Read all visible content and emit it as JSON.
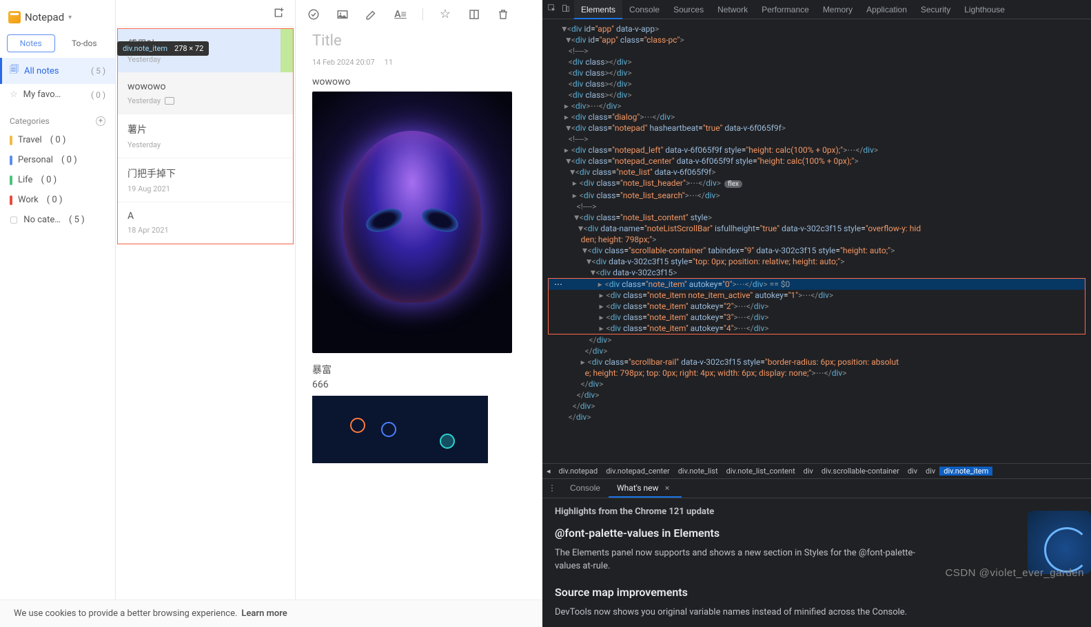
{
  "app": {
    "title": "Notepad",
    "tabs": {
      "notes": "Notes",
      "todos": "To-dos"
    },
    "nav": {
      "all": {
        "label": "All notes",
        "count": "( 5 )"
      },
      "fav": {
        "label": "My favo…",
        "count": "( 0 )"
      }
    },
    "categories_label": "Categories",
    "categories": [
      {
        "name": "Travel",
        "count": "( 0 )",
        "color": "#f5b942"
      },
      {
        "name": "Personal",
        "count": "( 0 )",
        "color": "#5b8def"
      },
      {
        "name": "Life",
        "count": "( 0 )",
        "color": "#4bc27d"
      },
      {
        "name": "Work",
        "count": "( 0 )",
        "color": "#e74c3c"
      },
      {
        "name": "No cate…",
        "count": "( 5 )",
        "color": "#c0c0c0"
      }
    ]
  },
  "tooltip": {
    "selector": "div.note_item",
    "dim": "278 × 72"
  },
  "notes": [
    {
      "title": "傅里叶",
      "date": "Yesterday",
      "hasImg": false,
      "state": "hover"
    },
    {
      "title": "wowowo",
      "date": "Yesterday",
      "hasImg": true,
      "state": "active"
    },
    {
      "title": "薯片",
      "date": "Yesterday",
      "hasImg": false,
      "state": ""
    },
    {
      "title": "门把手掉下",
      "date": "19 Aug 2021",
      "hasImg": false,
      "state": ""
    },
    {
      "title": "A",
      "date": "18 Apr 2021",
      "hasImg": false,
      "state": ""
    }
  ],
  "editor": {
    "title_placeholder": "Title",
    "meta_date": "14 Feb 2024 20:07",
    "meta_count": "11",
    "line1": "wowowo",
    "line2": "暴富",
    "line3": "666"
  },
  "cookie": {
    "text": "We use cookies to provide a better browsing experience.",
    "link": "Learn more"
  },
  "devtools": {
    "tabs": [
      "Elements",
      "Console",
      "Sources",
      "Network",
      "Performance",
      "Memory",
      "Application",
      "Security",
      "Lighthouse"
    ],
    "active_tab": "Elements",
    "crumbs": [
      "div.notepad",
      "div.notepad_center",
      "div.note_list",
      "div.note_list_content",
      "div",
      "div.scrollable-container",
      "div",
      "div",
      "div.note_item"
    ],
    "drawer": {
      "tabs": [
        "Console",
        "What's new"
      ],
      "active": "What's new",
      "highlights": "Highlights from the Chrome 121 update",
      "h1": "@font-palette-values in Elements",
      "p1": "The Elements panel now supports and shows a new section in Styles for the @font-palette-values at-rule.",
      "h2": "Source map improvements",
      "p2": "DevTools now shows you original variable names instead of minified across the Console."
    }
  },
  "watermark": "CSDN @violet_ever_garden"
}
